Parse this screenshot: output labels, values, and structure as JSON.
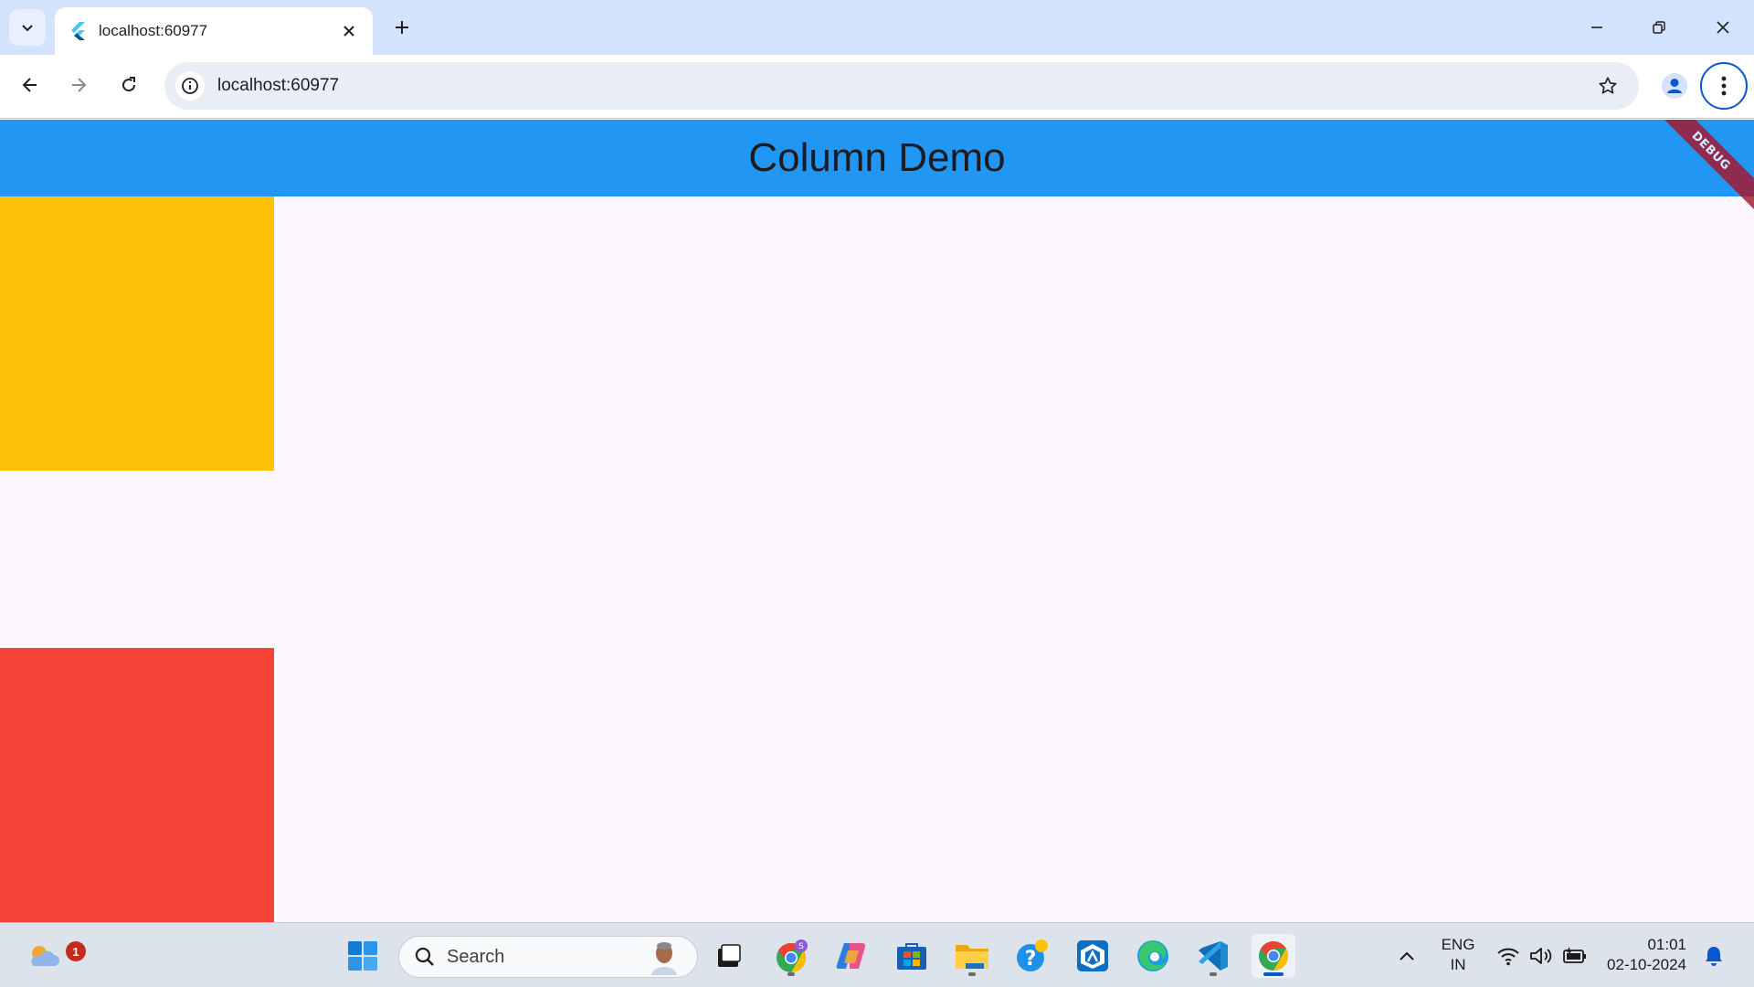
{
  "browser": {
    "tab": {
      "title": "localhost:60977"
    },
    "omnibox": {
      "url": "localhost:60977"
    }
  },
  "app": {
    "title": "Column Demo",
    "debug_banner": "DEBUG",
    "boxes": [
      {
        "color": "#ffc107"
      },
      {
        "color": "#f44336"
      }
    ]
  },
  "taskbar": {
    "weather_badge": "1",
    "search_placeholder": "Search",
    "apps": [
      "task-view",
      "chrome-profile",
      "copilot",
      "microsoft-store",
      "file-explorer",
      "get-help",
      "dell-app",
      "edge",
      "vscode",
      "chrome"
    ],
    "tray": {
      "language": "ENG",
      "region": "IN",
      "time": "01:01",
      "date": "02-10-2024"
    }
  }
}
